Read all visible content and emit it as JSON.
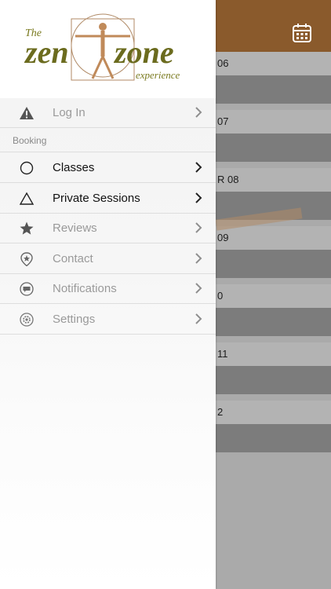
{
  "app": {
    "logo": {
      "line1": "The",
      "word1": "zen",
      "word2": "zone",
      "line2": "experience"
    },
    "accent_color": "#8a5a2c",
    "logo_color": "#6b6b1e"
  },
  "background": {
    "calendar_icon": "calendar-icon",
    "dates": [
      "06",
      "07",
      "R 08",
      "09",
      "0",
      "11",
      "2"
    ]
  },
  "drawer": {
    "items_top": [
      {
        "label": "Log In",
        "icon": "warning-icon"
      }
    ],
    "section_label": "Booking",
    "items_booking": [
      {
        "label": "Classes",
        "icon": "circle-icon",
        "active": true
      },
      {
        "label": "Private Sessions",
        "icon": "triangle-icon",
        "active": true
      },
      {
        "label": "Reviews",
        "icon": "star-icon",
        "active": false
      },
      {
        "label": "Contact",
        "icon": "location-pin-icon",
        "active": false
      },
      {
        "label": "Notifications",
        "icon": "chat-bubble-icon",
        "active": false
      },
      {
        "label": "Settings",
        "icon": "gear-icon",
        "active": false
      }
    ]
  }
}
